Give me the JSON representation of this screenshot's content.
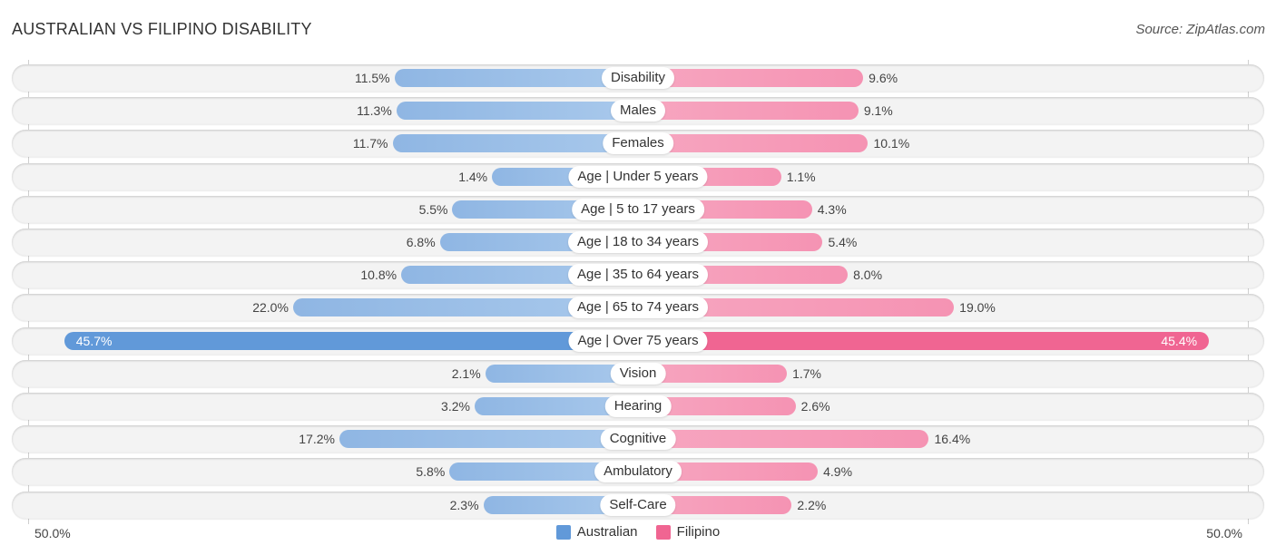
{
  "chart_data": {
    "type": "bar",
    "orientation": "horizontal-diverging",
    "title": "AUSTRALIAN VS FILIPINO DISABILITY",
    "source": "Source: ZipAtlas.com",
    "categories": [
      "Disability",
      "Males",
      "Females",
      "Age | Under 5 years",
      "Age | 5 to 17 years",
      "Age | 18 to 34 years",
      "Age | 35 to 64 years",
      "Age | 65 to 74 years",
      "Age | Over 75 years",
      "Vision",
      "Hearing",
      "Cognitive",
      "Ambulatory",
      "Self-Care"
    ],
    "series": [
      {
        "name": "Australian",
        "color": "#6199d9",
        "values": [
          11.5,
          11.3,
          11.7,
          1.4,
          5.5,
          6.8,
          10.8,
          22.0,
          45.7,
          2.1,
          3.2,
          17.2,
          5.8,
          2.3
        ]
      },
      {
        "name": "Filipino",
        "color": "#f06592",
        "values": [
          9.6,
          9.1,
          10.1,
          1.1,
          4.3,
          5.4,
          8.0,
          19.0,
          45.4,
          1.7,
          2.6,
          16.4,
          4.9,
          2.2
        ]
      }
    ],
    "value_labels_left": [
      "11.5%",
      "11.3%",
      "11.7%",
      "1.4%",
      "5.5%",
      "6.8%",
      "10.8%",
      "22.0%",
      "45.7%",
      "2.1%",
      "3.2%",
      "17.2%",
      "5.8%",
      "2.3%"
    ],
    "value_labels_right": [
      "9.6%",
      "9.1%",
      "10.1%",
      "1.1%",
      "4.3%",
      "5.4%",
      "8.0%",
      "19.0%",
      "45.4%",
      "1.7%",
      "2.6%",
      "16.4%",
      "4.9%",
      "2.2%"
    ],
    "xlim": [
      0,
      50
    ],
    "axis_labels": {
      "left": "50.0%",
      "right": "50.0%"
    },
    "legend": {
      "position": "bottom-center",
      "entries": [
        "Australian",
        "Filipino"
      ]
    },
    "grid": false
  }
}
